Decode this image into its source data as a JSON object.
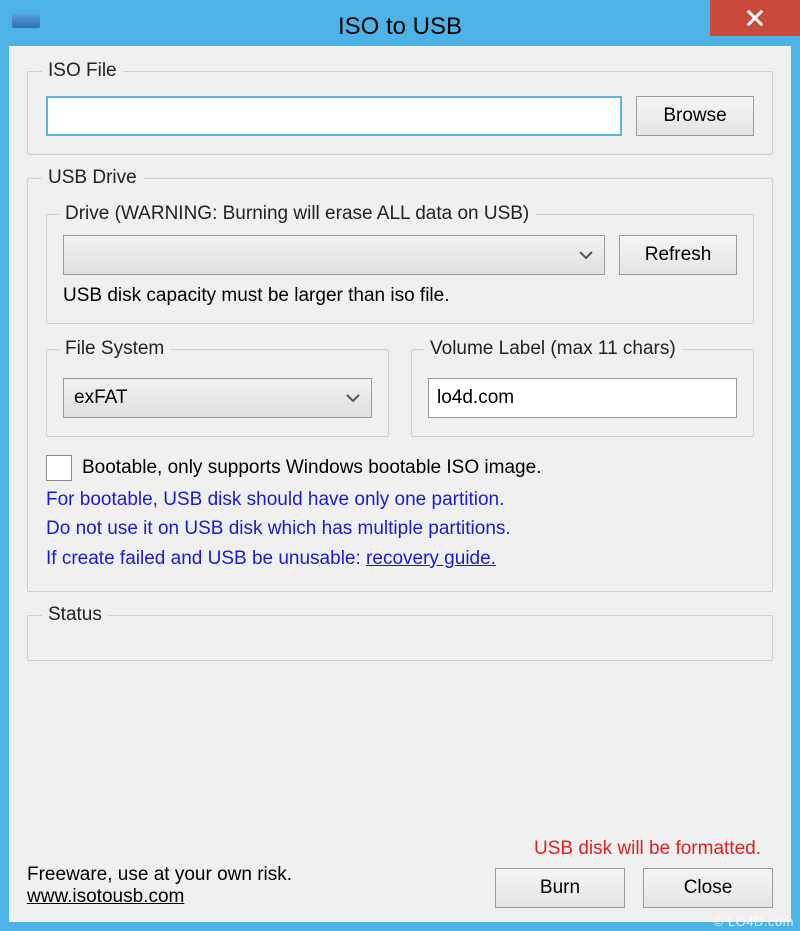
{
  "window": {
    "title": "ISO to USB"
  },
  "iso": {
    "legend": "ISO File",
    "path": "",
    "browse": "Browse"
  },
  "usb": {
    "legend": "USB Drive",
    "drive_legend": "Drive (WARNING: Burning will erase ALL data on USB)",
    "drive_selected": "",
    "refresh": "Refresh",
    "capacity_hint": "USB disk capacity must be larger than iso file.",
    "fs_legend": "File System",
    "fs_selected": "exFAT",
    "vol_legend": "Volume Label (max 11 chars)",
    "vol_value": "lo4d.com",
    "bootable_label": "Bootable, only supports Windows bootable ISO image.",
    "note1": "For bootable, USB disk should have only one partition.",
    "note2": "Do not use it on USB disk which has multiple partitions.",
    "note3_prefix": "If create failed and USB be unusable: ",
    "note3_link": "recovery guide."
  },
  "status": {
    "legend": "Status"
  },
  "footer": {
    "warn": "USB disk will be formatted.",
    "freeware": "Freeware, use at your own risk.",
    "site": "www.isotousb.com",
    "burn": "Burn",
    "close": "Close"
  },
  "watermark": "© LO4D.com"
}
